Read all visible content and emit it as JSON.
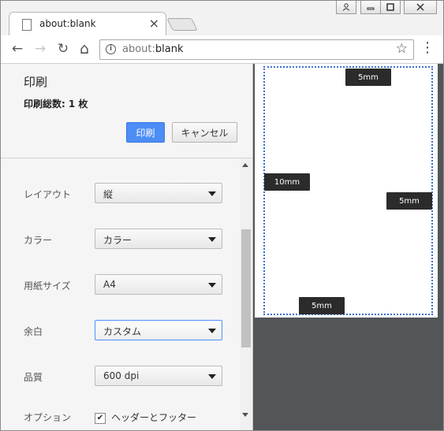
{
  "window": {
    "tab_title": "about:blank",
    "tab_close": "×",
    "controls": {
      "user": "⍝",
      "minimize": "▭",
      "maximize": "◻",
      "close": "✕"
    }
  },
  "toolbar": {
    "back": "←",
    "forward": "→",
    "reload": "↻",
    "home": "⌂",
    "info": "i",
    "url_prefix": "about:",
    "url_main": "blank",
    "star": "☆",
    "menu": "⋮"
  },
  "print": {
    "title": "印刷",
    "count_label": "印刷総数:",
    "count_value": "1 枚",
    "print_button": "印刷",
    "cancel_button": "キャンセル",
    "settings": [
      {
        "label": "レイアウト",
        "value": "縦"
      },
      {
        "label": "カラー",
        "value": "カラー"
      },
      {
        "label": "用紙サイズ",
        "value": "A4"
      },
      {
        "label": "余白",
        "value": "カスタム",
        "focused": true
      },
      {
        "label": "品質",
        "value": "600 dpi"
      }
    ],
    "options_label": "オプション",
    "options_checkbox": "ヘッダーとフッター",
    "options_checked": true
  },
  "preview": {
    "margin_top": "5mm",
    "margin_left": "10mm",
    "margin_right": "5mm",
    "margin_bottom": "5mm"
  },
  "colors": {
    "accent": "#4c8df6",
    "preview_bg": "#525659",
    "margin_guide": "#3b6fd1"
  }
}
